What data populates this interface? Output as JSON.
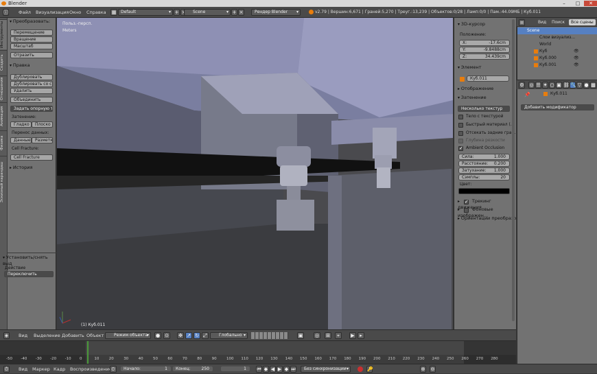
{
  "window": {
    "title": "Blender"
  },
  "infobar": {
    "menus": [
      "Файл",
      "Визуализация",
      "Окно",
      "Справка"
    ],
    "layout": "Default",
    "scene": "Scene",
    "engine": "Рендер Blender",
    "stats": "v2.79 | Вершин:6,671 | Граней:5,270 | Треуг.:13,239 | Объектов:0/28 | Ламп:0/0 | Пам.:44.09МБ | Куб.011"
  },
  "tabs": [
    "Инструменты",
    "Создать",
    "Отношения",
    "Анимация",
    "Физика",
    "Эскизный карандаш"
  ],
  "toolshelf": {
    "transform_title": "Преобразовать:",
    "move": "Перемещение",
    "rotate": "Вращение",
    "scale": "Масштаб",
    "mirror": "Отразить",
    "edit_title": "Правка",
    "duplicate": "Дублировать",
    "duplicate_linked": "Дублировать со св...",
    "delete": "Удалить",
    "join": "Объединить",
    "set_origin": "Задать опорную т...",
    "shading_label": "Затенение:",
    "smooth": "Гладко",
    "flat": "Плоско",
    "data_transfer_label": "Перенос данных:",
    "data": "Данные",
    "layout_btn": "Разметка",
    "cell_fracture_label": "Cell Fracture:",
    "cell_fracture": "Cell Fracture",
    "history_title": "История",
    "operator_title": "Установить/снять выд",
    "action_label": "Действие",
    "action_value": "Переключить"
  },
  "viewport": {
    "view_name": "Польз.-персп.",
    "units": "Meters",
    "object_label": "(1) Куб.011"
  },
  "npanel": {
    "cursor_title": "3D-курсор",
    "location_label": "Положение:",
    "x_label": "X:",
    "x_value": "-17.6cm",
    "y_label": "Y:",
    "y_value": "-9.8488cm",
    "z_label": "Z:",
    "z_value": "34.439cm",
    "item_title": "Элемент",
    "item_name": "Куб.011",
    "display_title": "Отображение",
    "shading_title": "Затенение",
    "shading_mode": "Несколько текстур",
    "textured_solid": "Тело с текстурой",
    "fast_material": "Быстрый материал (...",
    "backface_culling": "Отсекать задние гра...",
    "depth_of_field": "Глубина резкости",
    "ambient_occlusion": "Ambient Occlusion",
    "strength_label": "Сила:",
    "strength_value": "1.000",
    "distance_label": "Расстояние:",
    "distance_value": "0.200",
    "attenuation_label": "Затухание:",
    "attenuation_value": "1.000",
    "samples_label": "Сэмплы:",
    "samples_value": "20",
    "color_label": "Цвет:",
    "motion_tracking": "Трекинг движения",
    "background_images": "Фоновые изображен...",
    "transform_orientations": "Ориентации преобразо..."
  },
  "outliner": {
    "tabs": [
      "Вид",
      "Поиск",
      "Все сцены"
    ],
    "rows": [
      "Scene",
      "Слои визуализ...",
      "World",
      "Куб",
      "Куб.000",
      "Куб.001"
    ]
  },
  "properties": {
    "object_name": "Куб.011",
    "add_modifier": "Добавить модификатор"
  },
  "vpheader": {
    "view": "Вид",
    "select": "Выделение",
    "add": "Добавить",
    "object": "Объект",
    "mode": "Режим объекта",
    "orientation": "Глобально"
  },
  "timeline": {
    "ticks": [
      "-50",
      "-40",
      "-30",
      "-20",
      "-10",
      "0",
      "10",
      "20",
      "30",
      "40",
      "50",
      "60",
      "70",
      "80",
      "90",
      "100",
      "110",
      "120",
      "130",
      "140",
      "150",
      "160",
      "170",
      "180",
      "190",
      "200",
      "210",
      "220",
      "230",
      "240",
      "250",
      "260",
      "270",
      "280"
    ],
    "current_frame": "1"
  },
  "tlheader": {
    "view": "Вид",
    "marker": "Маркер",
    "frame": "Кадр",
    "playback": "Воспроизведение",
    "start_label": "Начало:",
    "start_value": "1",
    "end_label": "Конец:",
    "end_value": "250",
    "current": "1",
    "sync": "Без синхронизации"
  },
  "colors": {
    "accent": "#5680c2",
    "active_orange": "#e87d0d"
  }
}
